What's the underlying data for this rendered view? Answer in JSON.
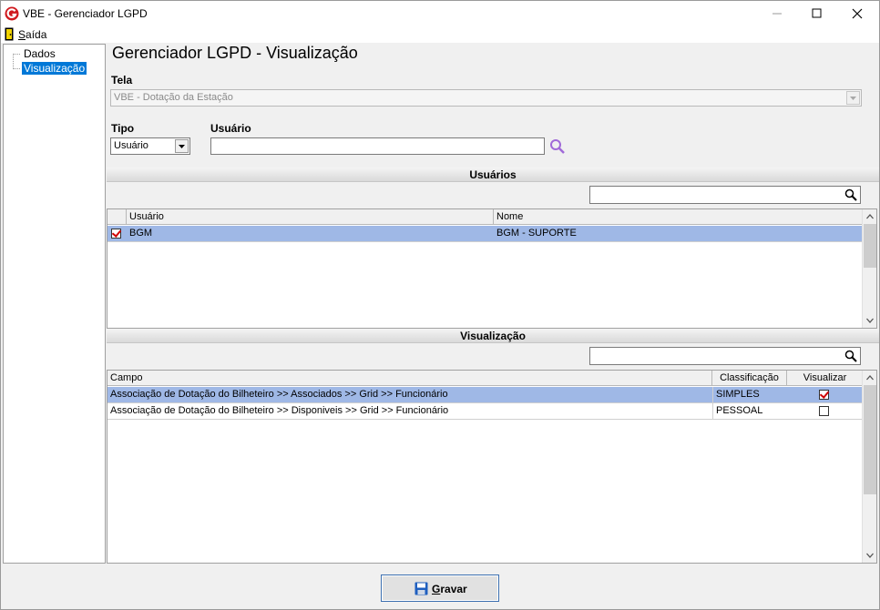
{
  "window": {
    "title": "VBE - Gerenciador LGPD"
  },
  "menu": {
    "saida_first": "S",
    "saida_rest": "aída"
  },
  "tree": {
    "items": [
      "Dados",
      "Visualização"
    ]
  },
  "main": {
    "heading": "Gerenciador LGPD - Visualização",
    "tela_label": "Tela",
    "tela_value": "VBE - Dotação da Estação",
    "tipo_label": "Tipo",
    "tipo_value": "Usuário",
    "usuario_label": "Usuário",
    "usuario_value": ""
  },
  "usuarios": {
    "title": "Usuários",
    "columns": [
      "Usuário",
      "Nome"
    ],
    "rows": [
      {
        "usuario": "BGM",
        "nome": "BGM - SUPORTE",
        "checked": true
      }
    ]
  },
  "visualizacao": {
    "title": "Visualização",
    "columns": [
      "Campo",
      "Classificação",
      "Visualizar"
    ],
    "rows": [
      {
        "campo": "Associação de Dotação do Bilheteiro >> Associados >> Grid >> Funcionário",
        "classificacao": "SIMPLES",
        "visualizar": true
      },
      {
        "campo": "Associação de Dotação do Bilheteiro >> Disponiveis >> Grid >> Funcionário",
        "classificacao": "PESSOAL",
        "visualizar": false
      }
    ]
  },
  "actions": {
    "gravar_first": "G",
    "gravar_rest": "ravar"
  },
  "colors": {
    "selection_row": "#9fb8e6",
    "tree_selected": "#0078d7",
    "accent_icon": "#a06ad8",
    "brand_red": "#d0191e"
  }
}
